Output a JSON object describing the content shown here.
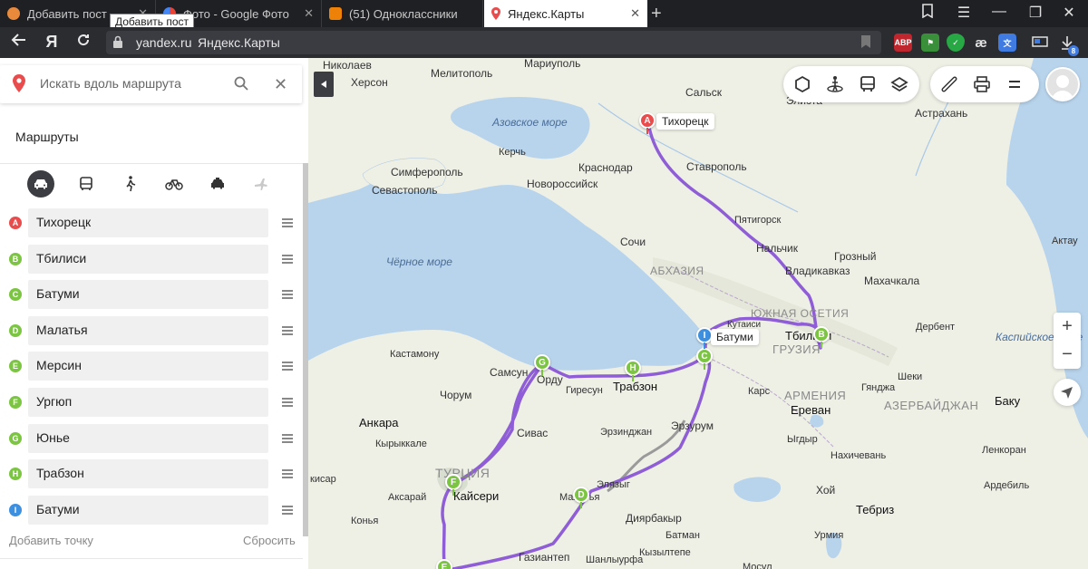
{
  "browser": {
    "tabs": [
      {
        "title": "Добавить пост"
      },
      {
        "title": "Фото - Google Фото"
      },
      {
        "title": "(51) Одноклассники"
      },
      {
        "title": "Яндекс.Карты"
      }
    ],
    "tooltip": "Добавить пост",
    "url_domain": "yandex.ru",
    "url_title": "Яндекс.Карты",
    "yandex_logo": "Я",
    "extensions": {
      "abp": "ABP",
      "badge": "8"
    }
  },
  "sidebar": {
    "search_placeholder": "Искать вдоль маршрута",
    "routes_title": "Маршруты",
    "waypoints": [
      {
        "letter": "A",
        "name": "Тихорецк",
        "color": "#e94c4c"
      },
      {
        "letter": "B",
        "name": "Тбилиси",
        "color": "#7cc543"
      },
      {
        "letter": "C",
        "name": "Батуми",
        "color": "#7cc543"
      },
      {
        "letter": "D",
        "name": "Малатья",
        "color": "#7cc543"
      },
      {
        "letter": "E",
        "name": "Мерсин",
        "color": "#7cc543"
      },
      {
        "letter": "F",
        "name": "Ургюп",
        "color": "#7cc543"
      },
      {
        "letter": "G",
        "name": "Юнье",
        "color": "#7cc543"
      },
      {
        "letter": "H",
        "name": "Трабзон",
        "color": "#7cc543"
      },
      {
        "letter": "I",
        "name": "Батуми",
        "color": "#3d8fe0"
      }
    ],
    "add_point": "Добавить точку",
    "reset": "Сбросить"
  },
  "map": {
    "route_color": "#8f5ed6",
    "labels": {
      "nikolaev": "Николаев",
      "kherson": "Херсон",
      "melitopol": "Мелитополь",
      "mariupol": "Мариуполь",
      "salsk": "Сальск",
      "elista": "Элиста",
      "astrakhan": "Астрахань",
      "azov_sea": "Азовское море",
      "tikhoretsk": "Тихорецк",
      "kerch": "Керчь",
      "krasnodar": "Краснодар",
      "stavropol": "Ставрополь",
      "simferopol": "Симферополь",
      "sevastopol": "Севастополь",
      "novorossiysk": "Новороссийск",
      "pyatigorsk": "Пятигорск",
      "sochi": "Сочи",
      "nalchik": "Нальчик",
      "grozny": "Грозный",
      "aktau": "Актау",
      "black_sea": "Чёрное море",
      "abkhazia": "АБХАЗИЯ",
      "vladikavkaz": "Владикавказ",
      "makhachkala": "Махачкала",
      "south_ossetia": "ЮЖНАЯ ОСЕТИЯ",
      "kutaisi": "Кутаиси",
      "derbent": "Дербент",
      "batumi": "Батуми",
      "tbilisi": "Тбилиси",
      "caspian_sea": "Каспийское море",
      "kastamonu": "Кастамону",
      "georgia": "ГРУЗИЯ",
      "samsun": "Самсун",
      "ordu": "Орду",
      "giresun": "Гиресун",
      "trabzon": "Трабзон",
      "sheki": "Шеки",
      "kars": "Карс",
      "armenia": "АРМЕНИЯ",
      "ganja": "Гянджа",
      "baku": "Баку",
      "yerevan": "Ереван",
      "azerbaijan": "АЗЕРБАЙДЖАН",
      "chorum": "Чорум",
      "ankara": "Анкара",
      "erzurum": "Эрзурум",
      "erzincan": "Эрзинджан",
      "kirikkale": "Кырыккале",
      "sivas": "Сивас",
      "igdyr": "Ыгдыр",
      "nakhchivan": "Нахичевань",
      "lenkoran": "Ленкоран",
      "ardebil": "Ардебиль",
      "turkey": "ТУРЦИЯ",
      "elazig": "Элязыг",
      "kayseri": "Кайсери",
      "khoy": "Хой",
      "malatya": "Малатья",
      "aksaray": "Аксарай",
      "tabriz": "Тебриз",
      "diyarbakir": "Диярбакыр",
      "konya": "Конья",
      "batman": "Батман",
      "urmia": "Урмия",
      "gaziantep": "Газиантеп",
      "kiziltepe": "Кызылтепе",
      "shanliurfa": "Шанлыурфа",
      "mosul": "Мосул",
      "kisar": "кисар"
    }
  }
}
